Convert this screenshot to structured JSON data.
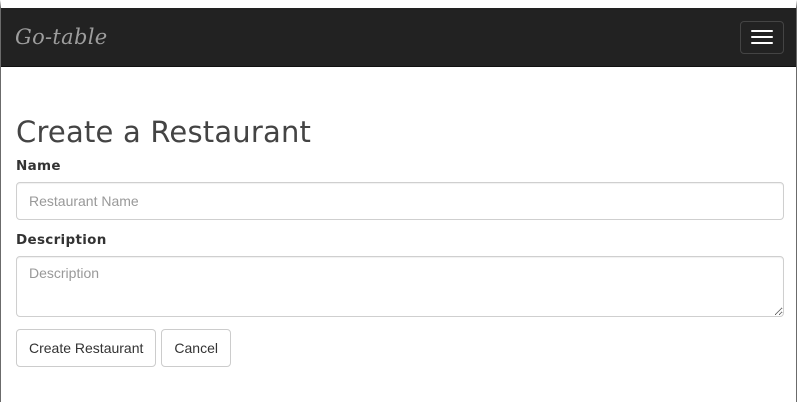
{
  "navbar": {
    "brand": "Go-table",
    "menu_icon": "hamburger-menu-icon",
    "background": "#222222"
  },
  "page": {
    "title": "Create a Restaurant"
  },
  "form": {
    "name": {
      "label": "Name",
      "value": "",
      "placeholder": "Restaurant Name"
    },
    "description": {
      "label": "Description",
      "value": "",
      "placeholder": "Description"
    },
    "submit_label": "Create Restaurant",
    "cancel_label": "Cancel"
  }
}
